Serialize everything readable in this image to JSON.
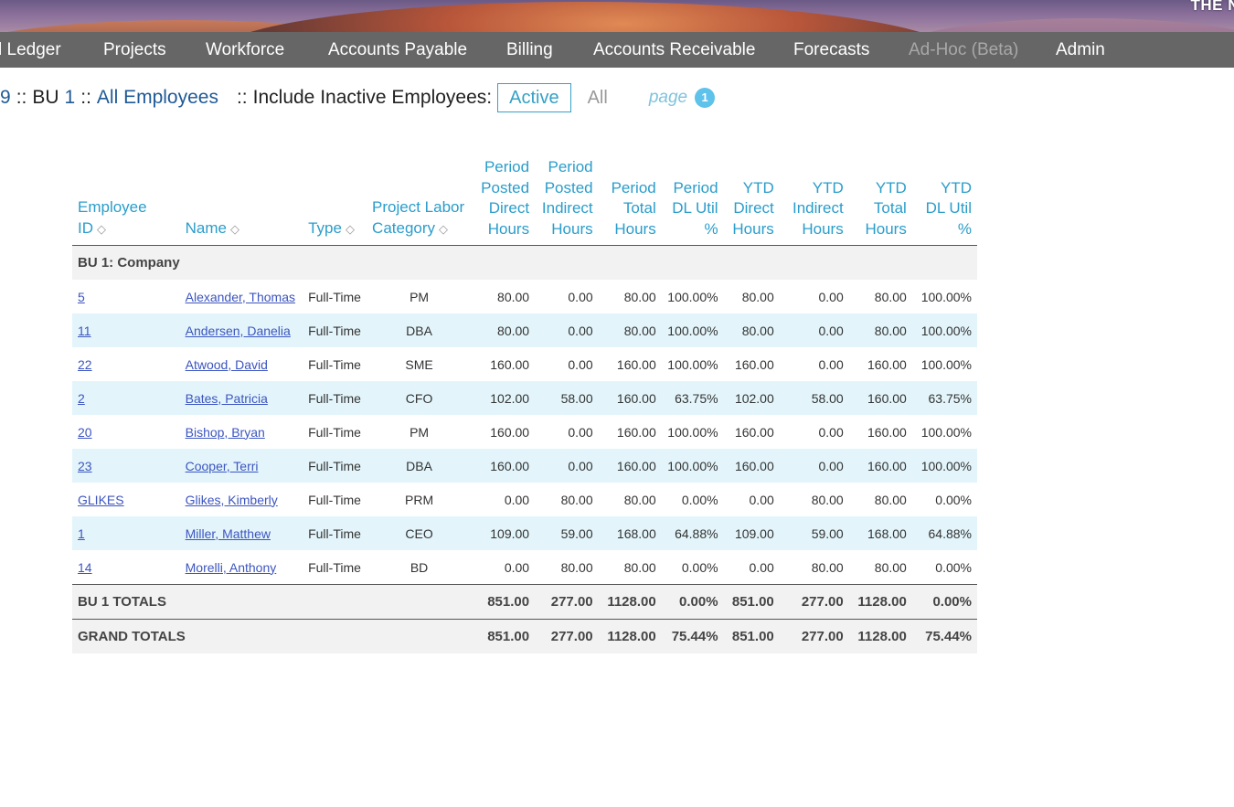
{
  "header": {
    "brand_text": "THE N",
    "nav": [
      {
        "label": "l Ledger",
        "disabled": false
      },
      {
        "label": "Projects",
        "disabled": false
      },
      {
        "label": "Workforce",
        "disabled": false
      },
      {
        "label": "Accounts Payable",
        "disabled": false
      },
      {
        "label": "Billing",
        "disabled": false
      },
      {
        "label": "Accounts Receivable",
        "disabled": false
      },
      {
        "label": "Forecasts",
        "disabled": false
      },
      {
        "label": "Ad-Hoc (Beta)",
        "disabled": true
      },
      {
        "label": "Admin",
        "disabled": false
      }
    ]
  },
  "breadcrumb": {
    "period": "9",
    "sep1": "::",
    "bu_label": "BU",
    "bu_value": "1",
    "sep2": "::",
    "employees": "All Employees",
    "sep3": "::",
    "inactive_label": "Include Inactive Employees:",
    "active_option": "Active",
    "all_option": "All",
    "page_label": "page",
    "page_number": "1"
  },
  "table": {
    "columns": [
      {
        "label": "Employee ID",
        "sortable": true
      },
      {
        "label": "Name",
        "sortable": true
      },
      {
        "label": "Type",
        "sortable": true
      },
      {
        "label": "Project Labor Category",
        "sortable": true
      },
      {
        "label": "Period Posted Direct Hours",
        "sortable": false
      },
      {
        "label": "Period Posted Indirect Hours",
        "sortable": false
      },
      {
        "label": "Period Total Hours",
        "sortable": false
      },
      {
        "label": "Period DL Util %",
        "sortable": false
      },
      {
        "label": "YTD Direct Hours",
        "sortable": false
      },
      {
        "label": "YTD Indirect Hours",
        "sortable": false
      },
      {
        "label": "YTD Total Hours",
        "sortable": false
      },
      {
        "label": "YTD DL Util %",
        "sortable": false
      }
    ],
    "sort_icon": "sort-updown-icon",
    "group_label": "BU 1: Company",
    "rows": [
      {
        "id": "5",
        "name": "Alexander, Thomas",
        "type": "Full-Time",
        "plc": "PM",
        "p_direct": "80.00",
        "p_indirect": "0.00",
        "p_total": "80.00",
        "p_util": "100.00%",
        "y_direct": "80.00",
        "y_indirect": "0.00",
        "y_total": "80.00",
        "y_util": "100.00%"
      },
      {
        "id": "11",
        "name": "Andersen, Danelia",
        "type": "Full-Time",
        "plc": "DBA",
        "p_direct": "80.00",
        "p_indirect": "0.00",
        "p_total": "80.00",
        "p_util": "100.00%",
        "y_direct": "80.00",
        "y_indirect": "0.00",
        "y_total": "80.00",
        "y_util": "100.00%"
      },
      {
        "id": "22",
        "name": "Atwood, David",
        "type": "Full-Time",
        "plc": "SME",
        "p_direct": "160.00",
        "p_indirect": "0.00",
        "p_total": "160.00",
        "p_util": "100.00%",
        "y_direct": "160.00",
        "y_indirect": "0.00",
        "y_total": "160.00",
        "y_util": "100.00%"
      },
      {
        "id": "2",
        "name": "Bates, Patricia",
        "type": "Full-Time",
        "plc": "CFO",
        "p_direct": "102.00",
        "p_indirect": "58.00",
        "p_total": "160.00",
        "p_util": "63.75%",
        "y_direct": "102.00",
        "y_indirect": "58.00",
        "y_total": "160.00",
        "y_util": "63.75%"
      },
      {
        "id": "20",
        "name": "Bishop, Bryan",
        "type": "Full-Time",
        "plc": "PM",
        "p_direct": "160.00",
        "p_indirect": "0.00",
        "p_total": "160.00",
        "p_util": "100.00%",
        "y_direct": "160.00",
        "y_indirect": "0.00",
        "y_total": "160.00",
        "y_util": "100.00%"
      },
      {
        "id": "23",
        "name": "Cooper, Terri",
        "type": "Full-Time",
        "plc": "DBA",
        "p_direct": "160.00",
        "p_indirect": "0.00",
        "p_total": "160.00",
        "p_util": "100.00%",
        "y_direct": "160.00",
        "y_indirect": "0.00",
        "y_total": "160.00",
        "y_util": "100.00%"
      },
      {
        "id": "GLIKES",
        "name": "Glikes, Kimberly",
        "type": "Full-Time",
        "plc": "PRM",
        "p_direct": "0.00",
        "p_indirect": "80.00",
        "p_total": "80.00",
        "p_util": "0.00%",
        "y_direct": "0.00",
        "y_indirect": "80.00",
        "y_total": "80.00",
        "y_util": "0.00%"
      },
      {
        "id": "1",
        "name": "Miller, Matthew",
        "type": "Full-Time",
        "plc": "CEO",
        "p_direct": "109.00",
        "p_indirect": "59.00",
        "p_total": "168.00",
        "p_util": "64.88%",
        "y_direct": "109.00",
        "y_indirect": "59.00",
        "y_total": "168.00",
        "y_util": "64.88%"
      },
      {
        "id": "14",
        "name": "Morelli, Anthony",
        "type": "Full-Time",
        "plc": "BD",
        "p_direct": "0.00",
        "p_indirect": "80.00",
        "p_total": "80.00",
        "p_util": "0.00%",
        "y_direct": "0.00",
        "y_indirect": "80.00",
        "y_total": "80.00",
        "y_util": "0.00%"
      }
    ],
    "totals": [
      {
        "label": "BU 1 TOTALS",
        "p_direct": "851.00",
        "p_indirect": "277.00",
        "p_total": "1128.00",
        "p_util": "0.00%",
        "y_direct": "851.00",
        "y_indirect": "277.00",
        "y_total": "1128.00",
        "y_util": "0.00%"
      },
      {
        "label": "GRAND TOTALS",
        "p_direct": "851.00",
        "p_indirect": "277.00",
        "p_total": "1128.00",
        "p_util": "75.44%",
        "y_direct": "851.00",
        "y_indirect": "277.00",
        "y_total": "1128.00",
        "y_util": "75.44%"
      }
    ]
  },
  "colors": {
    "nav_bg": "#666666",
    "link_blue": "#1f5a96",
    "header_cyan": "#2a9dcb",
    "alt_row": "#e3f5fb",
    "group_row": "#f2f2f2",
    "badge": "#5ec2ea"
  }
}
